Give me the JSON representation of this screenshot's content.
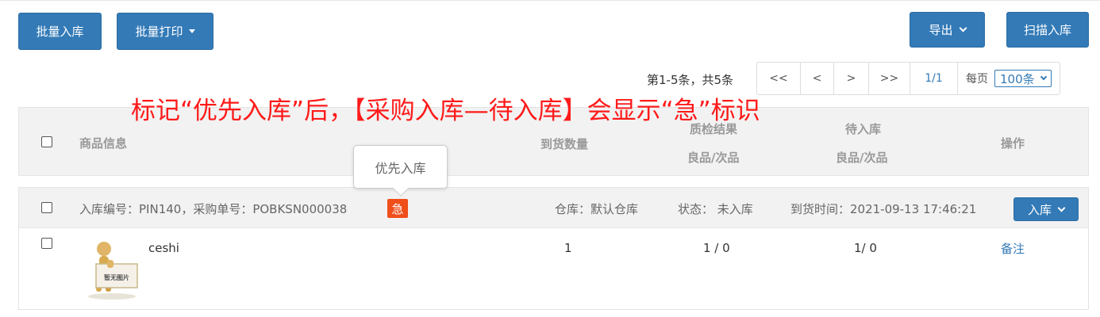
{
  "toolbar": {
    "batch_stock_in": "批量入库",
    "batch_print": "批量打印",
    "export": "导出",
    "scan_stock_in": "扫描入库"
  },
  "pager": {
    "info": "第1-5条，共5条",
    "first": "<<",
    "prev": "<",
    "next": ">",
    "last": ">>",
    "current": "1/1",
    "per_page_label": "每页",
    "per_page_value": "100条"
  },
  "annotation": "标记“优先入库”后，【采购入库—待入库】会显示“急”标识",
  "table": {
    "headers": {
      "product_info": "商品信息",
      "arrived_qty": "到货数量",
      "qc_result": "质检结果",
      "qc_sub": "良品/次品",
      "pending": "待入库",
      "pending_sub": "良品/次品",
      "actions": "操作"
    }
  },
  "tooltip": "优先入库",
  "group": {
    "info": "入库编号：PIN140，采购单号：POBKSN000038",
    "urgent_badge": "急",
    "warehouse": "仓库：默认仓库",
    "status": "状态： 未入库",
    "arrival_time": "到货时间：2021-09-13 17:46:21",
    "stock_in_button": "入库"
  },
  "row": {
    "product_name": "ceshi",
    "thumbnail_text": "暂无图片",
    "arrived_qty": "1",
    "qc": "1 / 0",
    "pending": "1/ 0",
    "remark_link": "备注"
  },
  "colors": {
    "primary": "#337ab7",
    "annotation": "#ff1a1a",
    "urgent": "#f04e1a"
  }
}
